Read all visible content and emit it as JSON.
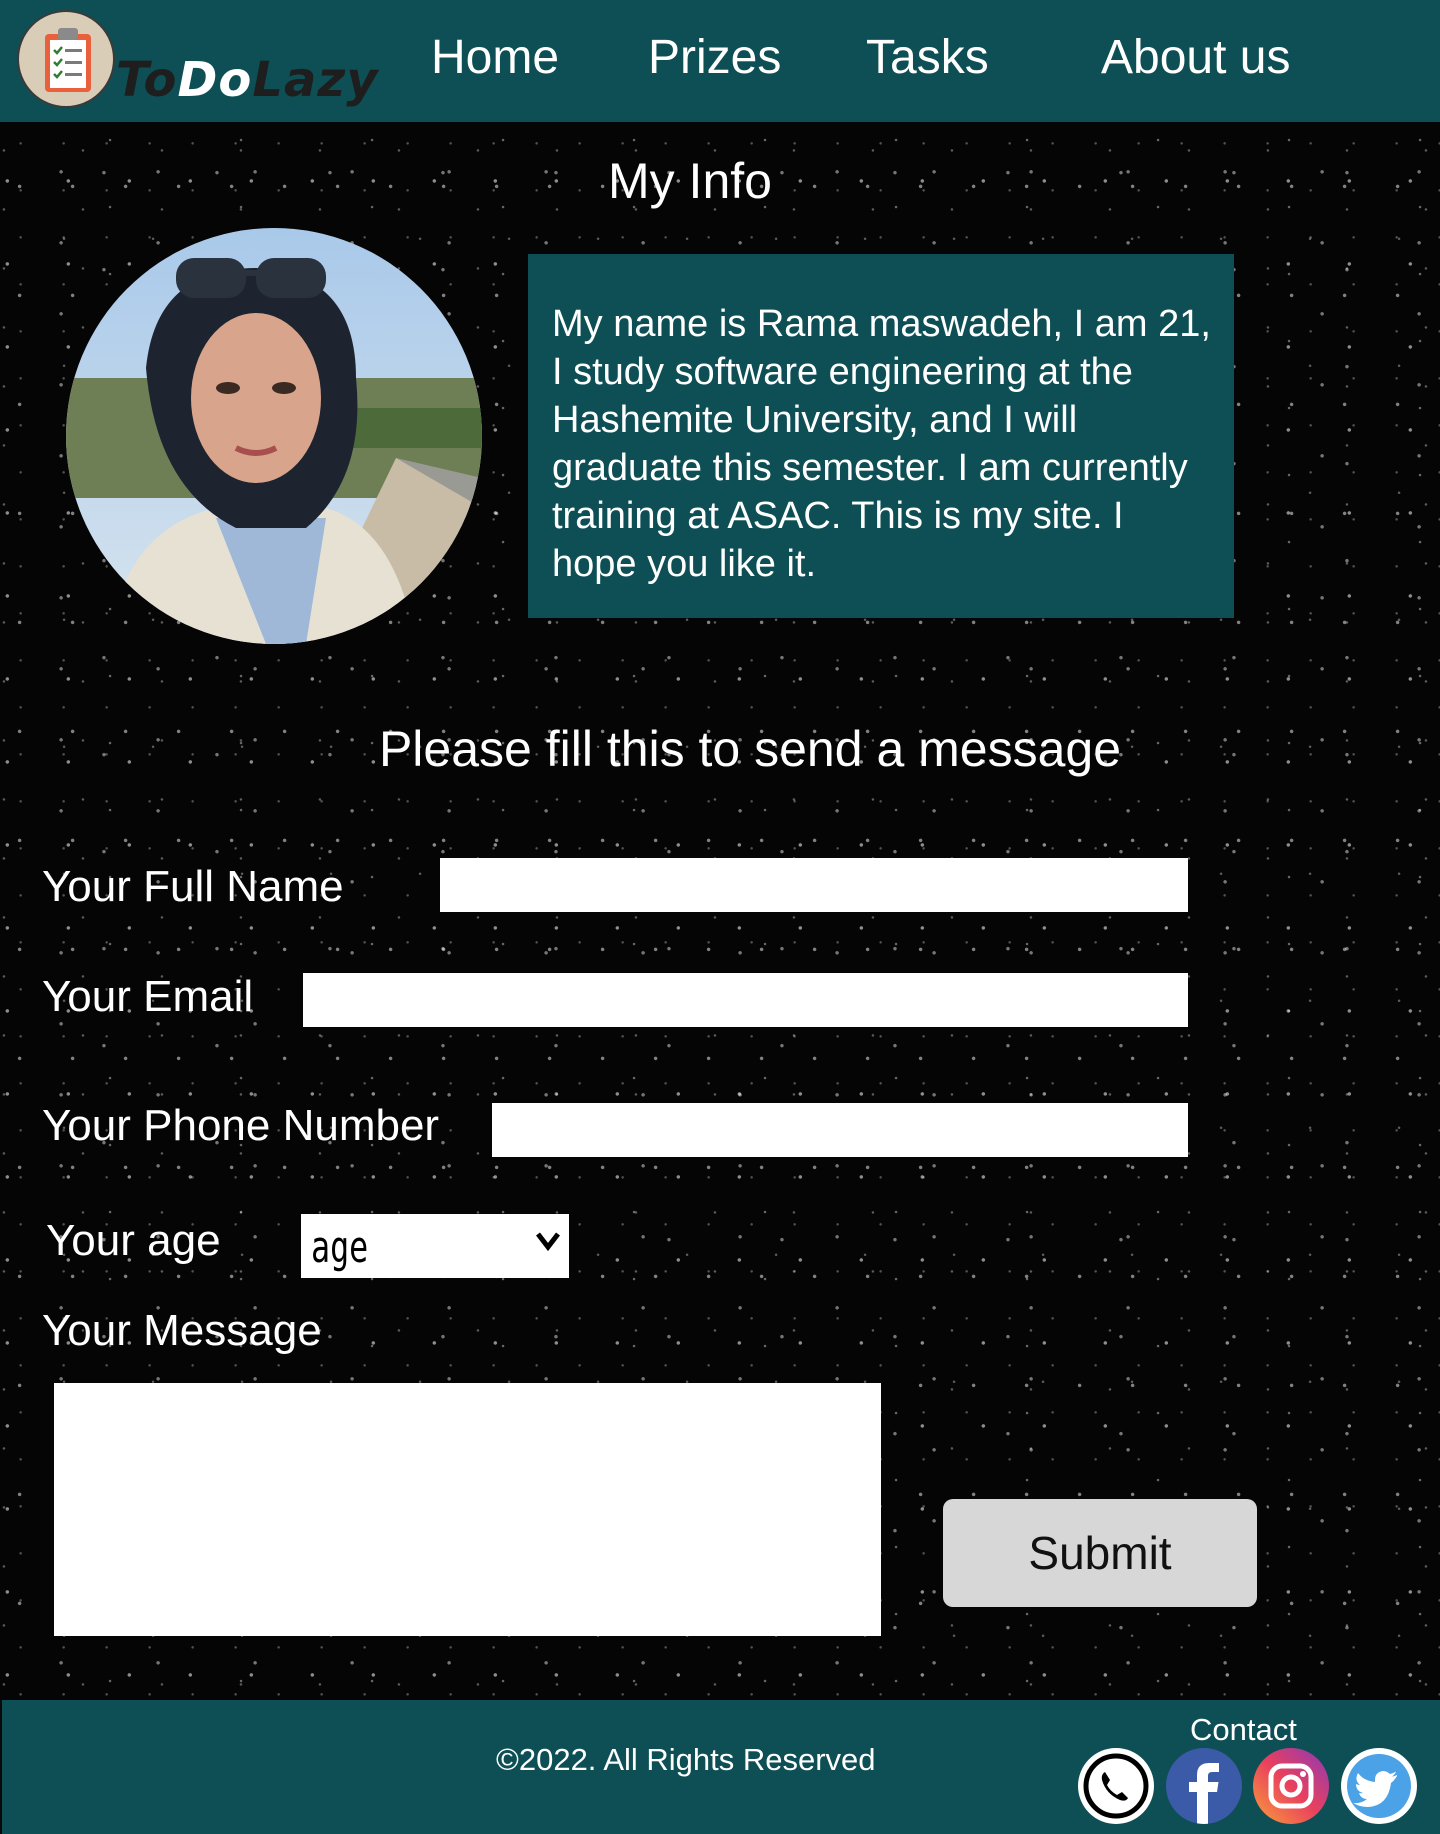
{
  "header": {
    "brand": {
      "part1": "To",
      "part2": "Do",
      "part3": "Lazy"
    },
    "nav": [
      {
        "label": "Home"
      },
      {
        "label": "Prizes"
      },
      {
        "label": "Tasks"
      },
      {
        "label": "About us"
      }
    ]
  },
  "info": {
    "title": "My Info",
    "bio": "My name is Rama maswadeh, I am 21, I study software engineering at the Hashemite University, and I will graduate this semester. I am currently training at ASAC. This is my site. I hope you like it."
  },
  "form": {
    "heading": "Please fill this to send a message",
    "full_name_label": "Your Full Name",
    "email_label": "Your Email",
    "phone_label": "Your Phone Number",
    "age_label": "Your age",
    "age_selected": "age",
    "message_label": "Your Message",
    "submit_label": "Submit"
  },
  "footer": {
    "copyright": "©2022. All Rights Reserved",
    "contact_label": "Contact",
    "social_icons": [
      "phone-icon",
      "facebook-icon",
      "instagram-icon",
      "twitter-icon"
    ]
  },
  "colors": {
    "header_bg": "#0d4f55",
    "page_bg": "#050505",
    "button_bg": "#d7d7d7"
  }
}
